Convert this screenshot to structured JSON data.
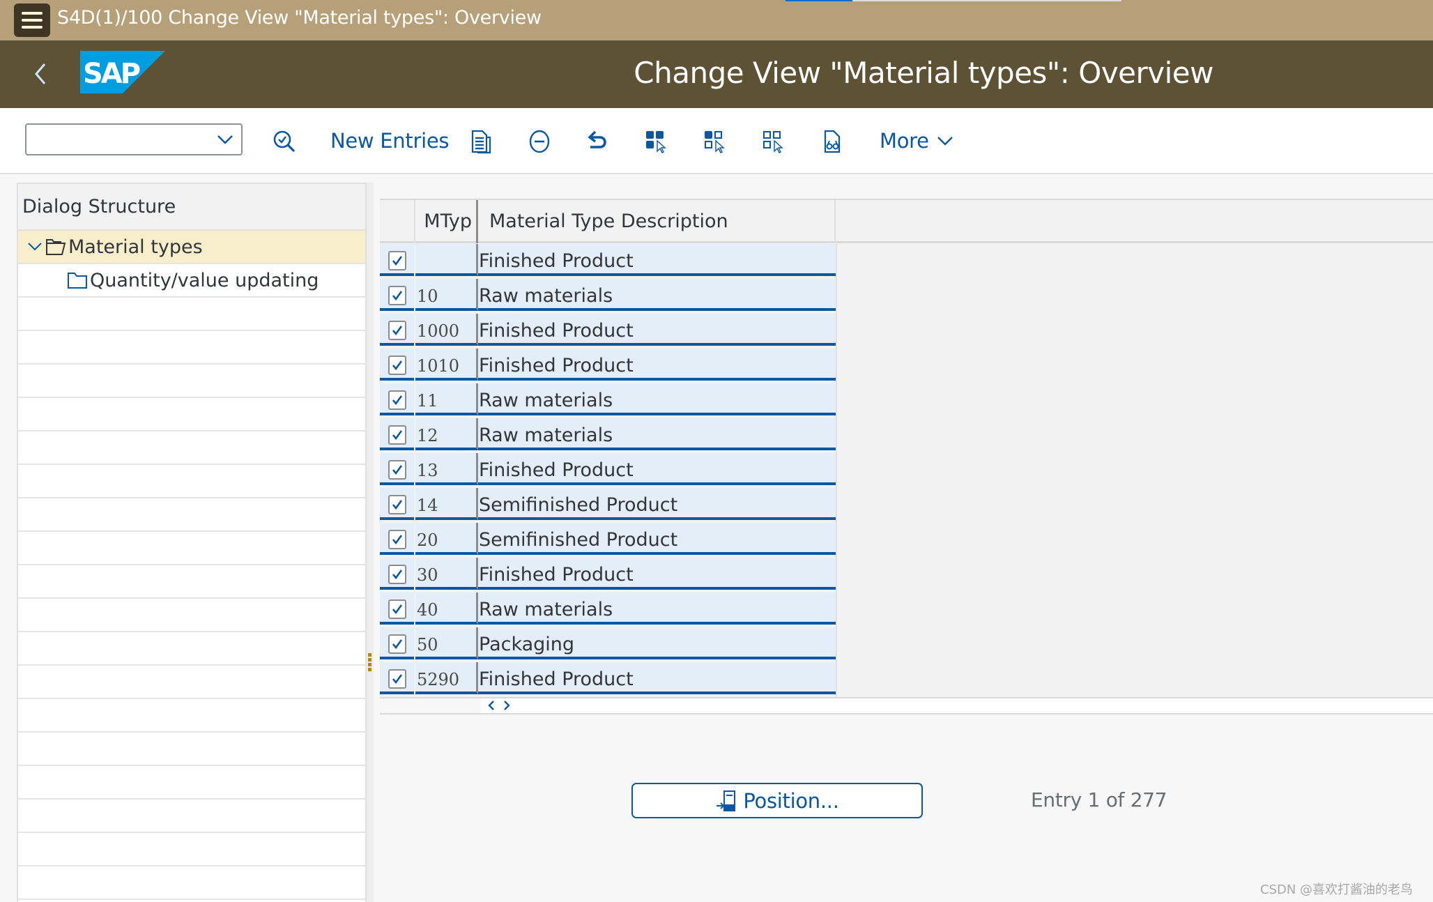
{
  "window": {
    "title": "S4D(1)/100 Change View \"Material types\": Overview",
    "loading_progress_percent": 20
  },
  "header": {
    "logo_text": "SAP",
    "page_title": "Change View \"Material types\": Overview"
  },
  "toolbar": {
    "dropdown_value": "",
    "new_entries_label": "New Entries",
    "more_label": "More",
    "icons": [
      "search-check-icon",
      "copy-as-icon",
      "delete-icon",
      "undo-icon",
      "select-all-icon",
      "select-block-icon",
      "deselect-all-icon",
      "print-preview-icon"
    ]
  },
  "dialog_structure": {
    "title": "Dialog Structure",
    "items": [
      {
        "label": "Material types",
        "selected": true,
        "expanded": true,
        "icon": "folder-open-icon"
      },
      {
        "label": "Quantity/value updating",
        "selected": false,
        "icon": "folder-icon"
      }
    ]
  },
  "table": {
    "columns": [
      "MTyp",
      "Material Type Description"
    ],
    "rows": [
      {
        "checked": true,
        "mtyp": "",
        "description": "Finished Product"
      },
      {
        "checked": true,
        "mtyp": "10",
        "description": "Raw materials"
      },
      {
        "checked": true,
        "mtyp": "1000",
        "description": "Finished Product"
      },
      {
        "checked": true,
        "mtyp": "1010",
        "description": "Finished Product"
      },
      {
        "checked": true,
        "mtyp": "11",
        "description": "Raw materials"
      },
      {
        "checked": true,
        "mtyp": "12",
        "description": "Raw materials"
      },
      {
        "checked": true,
        "mtyp": "13",
        "description": "Finished Product"
      },
      {
        "checked": true,
        "mtyp": "14",
        "description": "Semifinished Product"
      },
      {
        "checked": true,
        "mtyp": "20",
        "description": "Semifinished Product"
      },
      {
        "checked": true,
        "mtyp": "30",
        "description": "Finished Product"
      },
      {
        "checked": true,
        "mtyp": "40",
        "description": "Raw materials"
      },
      {
        "checked": true,
        "mtyp": "50",
        "description": "Packaging"
      },
      {
        "checked": true,
        "mtyp": "5290",
        "description": "Finished Product"
      }
    ]
  },
  "footer": {
    "position_button_label": "Position...",
    "entry_info": "Entry 1 of 277"
  },
  "watermark": "CSDN @喜欢打酱油的老鸟",
  "colors": {
    "topbar": "#b5a07a",
    "header": "#5e5235",
    "accent": "#0a57a4",
    "selected_tree_row": "#f9eecb",
    "row_bg": "#e4eef8",
    "sap_logo": "#009de0"
  }
}
